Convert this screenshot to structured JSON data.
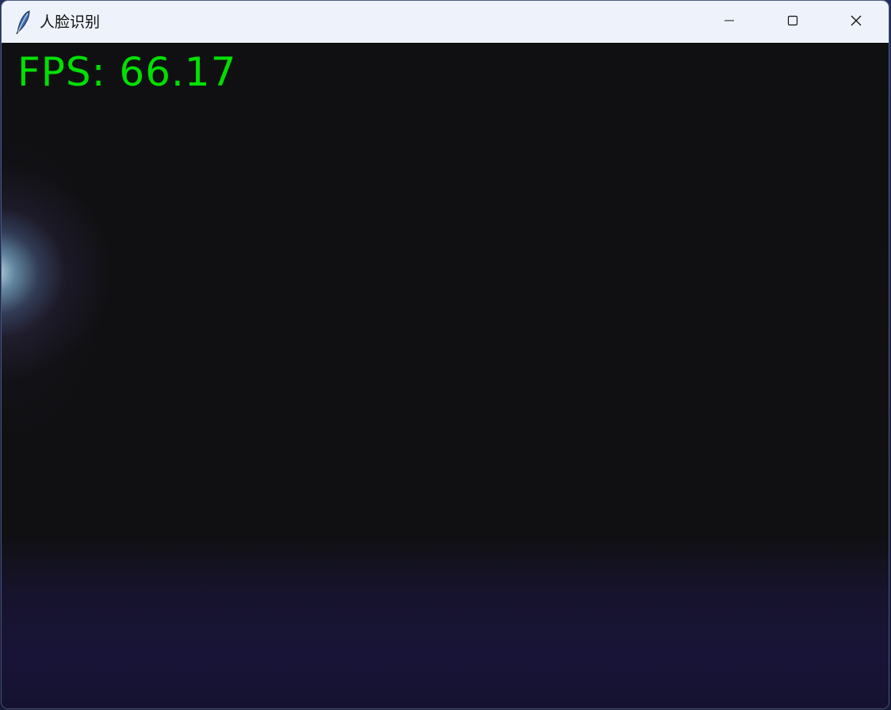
{
  "window": {
    "title": "人脸识别",
    "app_icon": "feather-icon",
    "controls": {
      "minimize": "minimize-icon",
      "maximize": "maximize-icon",
      "close": "close-icon"
    }
  },
  "video": {
    "overlay_text": "FPS: 66.17",
    "overlay_color": "#00e000"
  }
}
